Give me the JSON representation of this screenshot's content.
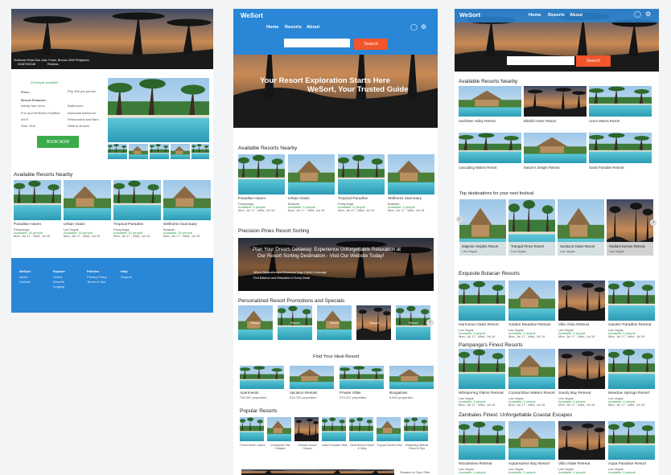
{
  "page1": {
    "hero_caption": "Sunflower Road San Jose, Porac, Bicolan 3009 Philippines",
    "hero_phone": "09487392348",
    "hero_reviews": "Reviews",
    "reviews_link": "29 people available",
    "price_label": "Price:",
    "price_value": "Php 300 per person",
    "features_label": "Resort Features:",
    "features_left": [
      "Infinity free room",
      "Fun and Wellness Facilities",
      "Wi-Fi",
      "Kids' Club"
    ],
    "features_right": [
      "Bathrooms",
      "Individual bathroom",
      "Restaurants and Bars",
      "Walk-in shower"
    ],
    "book_button": "BOOK NOW",
    "nearby_title": "Available Resorts Nearby",
    "nearby": [
      {
        "name": "Paradise Haven",
        "loc": "Pampanga",
        "avail": "Available: 20 people",
        "dates": "Mon, Jul 17 - Wed, Jul 19"
      },
      {
        "name": "Urban Oasis",
        "loc": "Las Vegas",
        "avail": "Available: 15 people",
        "dates": "Mon, Jul 17 - Wed, Jul 19"
      },
      {
        "name": "Tropical Paradise",
        "loc": "Pampanga",
        "avail": "Available: 20 people",
        "dates": "Mon, Jul 17 - Wed, Jul 19"
      },
      {
        "name": "Wellness Sanctuary",
        "loc": "Bulacan",
        "avail": "Available: 20 people",
        "dates": "Mon, Jul 17 - Wed, Jul 19"
      }
    ],
    "footer": {
      "cols": [
        {
          "head": "WeSort",
          "items": [
            "About",
            "Contact"
          ]
        },
        {
          "head": "Explore",
          "items": [
            "Hotels",
            "Resorts",
            "Lodging"
          ]
        },
        {
          "head": "Policies",
          "items": [
            "Privacy Policy",
            "Terms of Use"
          ]
        },
        {
          "head": "Help",
          "items": [
            "Support"
          ]
        }
      ]
    }
  },
  "page2": {
    "brand": "WeSort",
    "nav": [
      "Home",
      "Resorts",
      "About"
    ],
    "search_button": "Search",
    "search_placeholder": "",
    "hero_line1": "Your Resort Exploration Starts Here",
    "hero_line2": "WeSort, Your Trusted Guide",
    "nearby_title": "Available Resorts Nearby",
    "nearby": [
      {
        "name": "Paradise Haven",
        "loc": "Pampanga",
        "avail": "Available: 5 people",
        "dates": "Mon, Jul 17 - Wed, Jul 19"
      },
      {
        "name": "Urban Oasis",
        "loc": "Bulacan",
        "avail": "Available: 5 people",
        "dates": "Mon, Jul 17 - Wed, Jul 19"
      },
      {
        "name": "Tropical Paradise",
        "loc": "Pampanga",
        "avail": "Available: 5 people",
        "dates": "Mon, Jul 17 - Wed, Jul 19"
      },
      {
        "name": "Wellness Sanctuary",
        "loc": "Bulacan",
        "avail": "Available: 5 people",
        "dates": "Mon, Jul 17 - Wed, Jul 19"
      }
    ],
    "sorting_title": "Precision Pines Resort Sorting",
    "banner_line1": "Plan Your Dream Getaway: Experience Unforgettable Relaxation at",
    "banner_line2": "Our Resort Sorting Destination - Visit Our Website Today!",
    "banner_sub1": "Where Relaxation and Wondrous Days Gather Coverage",
    "banner_sub2": "Find Balance and Relaxation in Every Detail",
    "promos_title": "Personalized Resort Promotions and Specials",
    "promos": [
      "Resort",
      "Resort",
      "Resort",
      "Resort",
      "Resort"
    ],
    "ideal_title": "Find Your Ideal Resort",
    "ideal": [
      {
        "name": "Apartments",
        "count": "790,000 properties"
      },
      {
        "name": "Vacation Rentals",
        "count": "519,700 properties"
      },
      {
        "name": "Private Villas",
        "count": "374,107 properties"
      },
      {
        "name": "Bungalows",
        "count": "8,600 properties"
      }
    ],
    "popular_title": "Popular Resorts",
    "popular": [
      "Forest Haven Cabins",
      "Countryside Villa Cottages",
      "Seaside Sunset Houses",
      "Island Paradise Villas",
      "Oasis Breeze Resort & Villas",
      "Tropical Dreams Villa",
      "Whispering Willows Resort & Spa"
    ],
    "bottom_text": "Situated In Spa Offer"
  },
  "page3": {
    "brand": "WeSort",
    "nav": [
      "Home",
      "Resorts",
      "About"
    ],
    "search_button": "Search",
    "nearby_title": "Available Resorts Nearby",
    "nearby": [
      "Sunflower Valley Retreat",
      "Blissful Haven Resort",
      "Azure Waves Resort",
      "Cascading Waters Resort",
      "Nature's Delight Retreat",
      "Oasis Paradise Retreat"
    ],
    "top_title": "Top destinations for your next festival.",
    "top": [
      {
        "name": "Majestic Heights Resort",
        "loc": "Las Vegas"
      },
      {
        "name": "Tranquil Pines Resort",
        "loc": "Las Vegas"
      },
      {
        "name": "Sunburst Oasis Resort",
        "loc": "Las Vegas"
      },
      {
        "name": "Radiant Sunset Retreat",
        "loc": "Las Vegas"
      }
    ],
    "bulacan_title": "Exquisite Bulacan Resorts",
    "bulacan": [
      {
        "name": "Harmonia Oasis Resort",
        "loc": "Las Vegas",
        "avail": "Available: 5 people",
        "dates": "Mon, Jul 17 - Wed, Jul 19"
      },
      {
        "name": "Golden Meadow Retreat",
        "loc": "Las Vegas",
        "avail": "Available: 5 people",
        "dates": "Mon, Jul 17 - Wed, Jul 19"
      },
      {
        "name": "Villa Vista Retreat",
        "loc": "Las Vegas",
        "avail": "Available: 5 people",
        "dates": "Mon, Jul 17 - Wed, Jul 19"
      },
      {
        "name": "Garden Paradise Retreat",
        "loc": "Las Vegas",
        "avail": "Available: 5 people",
        "dates": "Mon, Jul 17 - Wed, Jul 19"
      }
    ],
    "pampanga_title": "Pampanga's Finest Resorts",
    "pampanga": [
      {
        "name": "Whispering Palms Retreat",
        "loc": "Las Vegas",
        "avail": "Available: 5 people",
        "dates": "Mon, Jul 17 - Wed, Jul 19"
      },
      {
        "name": "Crystal Blue Waters Resort",
        "loc": "Las Vegas",
        "avail": "Available: 5 people",
        "dates": "Mon, Jul 17 - Wed, Jul 19"
      },
      {
        "name": "Sandy Bay Retreat",
        "loc": "Las Vegas",
        "avail": "Available: 5 people",
        "dates": "Mon, Jul 17 - Wed, Jul 19"
      },
      {
        "name": "Meadow Springs Resort",
        "loc": "Las Vegas",
        "avail": "Available: 5 people",
        "dates": "Mon, Jul 17 - Wed, Jul 19"
      }
    ],
    "zambales_title": "Zambales Finest: Unforgettable Coastal Escapes",
    "zambales": [
      {
        "name": "Woodsview Retreat",
        "loc": "Las Vegas",
        "avail": "Available: 5 people"
      },
      {
        "name": "Aquamarine Bay Resort",
        "loc": "Las Vegas",
        "avail": "Available: 5 people"
      },
      {
        "name": "Villa Vitale Retreat",
        "loc": "Las Vegas",
        "avail": "Available: 5 people"
      },
      {
        "name": "Aqua Paradise Resort",
        "loc": "Las Vegas",
        "avail": "Available: 5 people"
      }
    ]
  },
  "colors": {
    "brand_blue": "#2a86d6",
    "search_orange": "#f2542b",
    "book_green": "#3aac4a"
  }
}
